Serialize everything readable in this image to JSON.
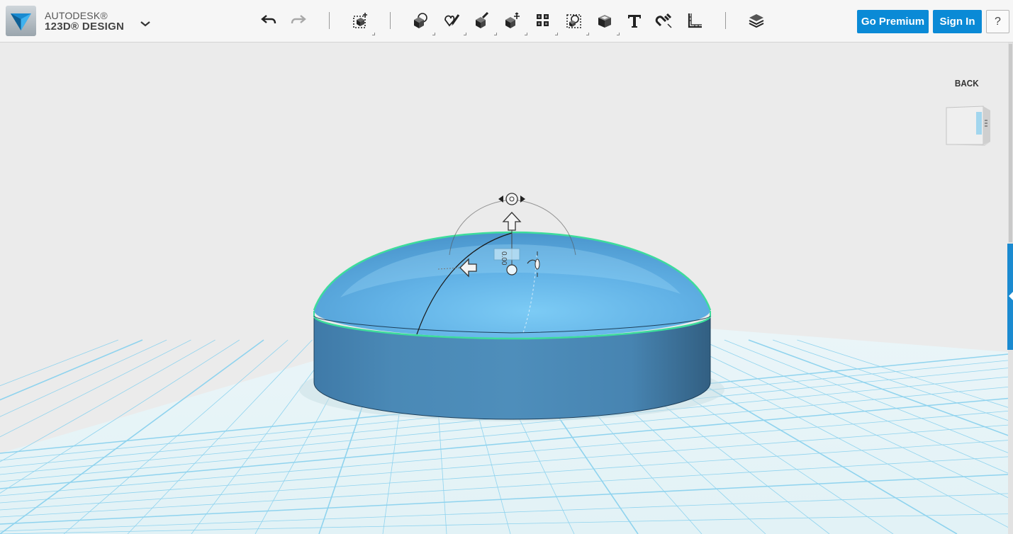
{
  "app": {
    "brand_top": "AUTODESK®",
    "brand_bottom": "123D® DESIGN"
  },
  "toolbar": {
    "tools": [
      {
        "name": "undo-icon"
      },
      {
        "name": "redo-icon"
      },
      {
        "name": "transform-icon"
      },
      {
        "name": "primitives-icon"
      },
      {
        "name": "sketch-icon"
      },
      {
        "name": "construct-icon"
      },
      {
        "name": "modify-icon"
      },
      {
        "name": "pattern-icon"
      },
      {
        "name": "grouping-icon"
      },
      {
        "name": "combine-icon"
      },
      {
        "name": "text-icon"
      },
      {
        "name": "snap-icon"
      },
      {
        "name": "measure-icon"
      },
      {
        "name": "material-icon"
      }
    ],
    "premium_label": "Go Premium",
    "signin_label": "Sign In",
    "help_label": "?"
  },
  "viewport": {
    "viewcube_face": "BACK",
    "dimension_value": "0.00"
  },
  "colors": {
    "accent": "#0a8ad6",
    "shape_side": "#4a88b4",
    "shape_dome": "#6cb9e8",
    "selection": "#3ddc9c",
    "grid_line": "#7fd0ee",
    "grid_floor": "#e5f4f8"
  }
}
